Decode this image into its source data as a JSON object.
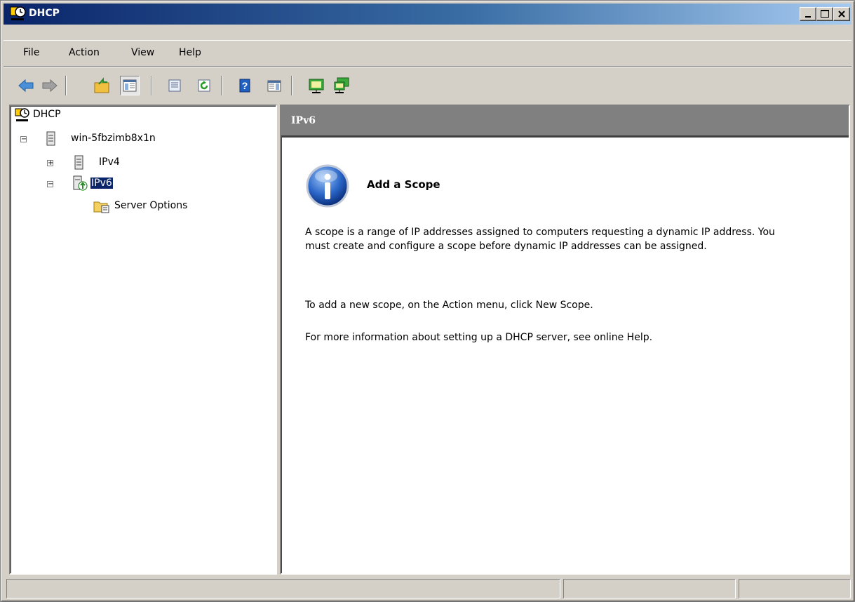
{
  "window": {
    "title": "DHCP"
  },
  "menu": {
    "items": [
      "File",
      "Action",
      "View",
      "Help"
    ]
  },
  "toolbar": {
    "buttons": [
      "back-icon",
      "forward-icon",
      "up-folder-icon",
      "show-hide-tree-icon",
      "properties-icon",
      "refresh-icon",
      "help-icon",
      "show-hide-action-pane-icon",
      "server-icon-1",
      "server-icon-2"
    ]
  },
  "tree": {
    "root": "DHCP",
    "server": "win-5fbzimb8x1n",
    "ipv4": "IPv4",
    "ipv6": "IPv6",
    "server_options": "Server Options"
  },
  "content": {
    "header": "IPv6",
    "heading": "Add a Scope",
    "para1": "A scope is a range of IP addresses assigned to computers requesting a dynamic IP address. You must create and configure a scope before dynamic IP addresses can be assigned.",
    "para2": "To add a new scope, on the Action menu, click New Scope.",
    "para3": "For more information about setting up a DHCP server, see online Help."
  },
  "colors": {
    "title_start": "#0a246a",
    "title_end": "#a6caf0",
    "chrome": "#d4d0c8",
    "header_gray": "#808080"
  }
}
